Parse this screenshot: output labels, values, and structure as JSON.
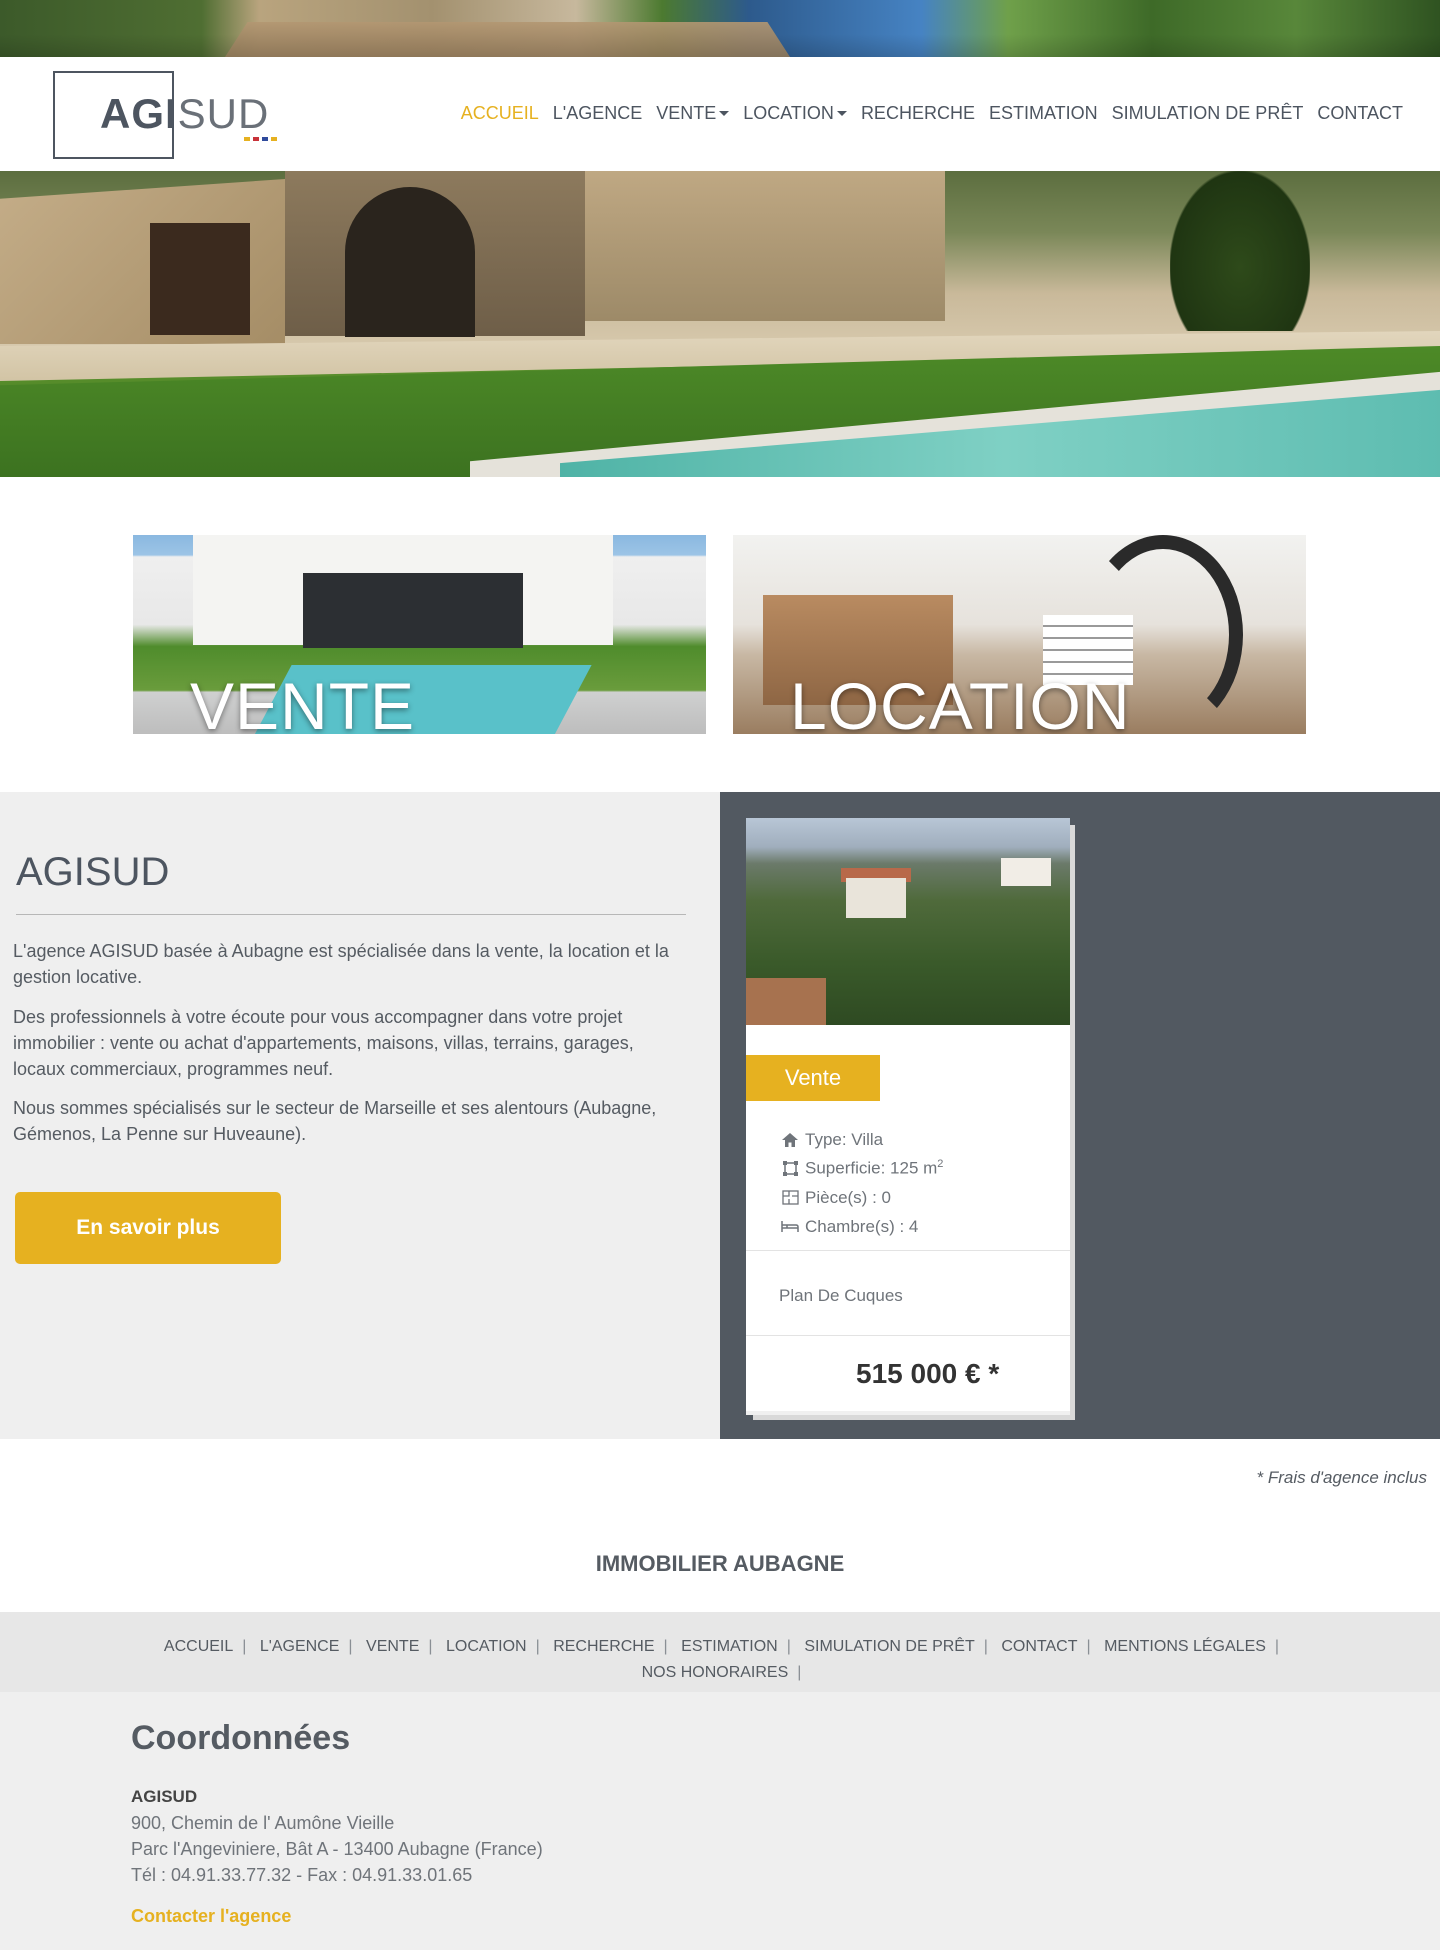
{
  "header": {
    "logo": {
      "part1": "AGI",
      "part2": "SUD",
      "colors": [
        "#e6b120",
        "#c8323a",
        "#2f4a9c",
        "#e6b120"
      ]
    },
    "nav": [
      {
        "label": "ACCUEIL",
        "active": true
      },
      {
        "label": "L'AGENCE"
      },
      {
        "label": "VENTE",
        "dropdown": true
      },
      {
        "label": "LOCATION",
        "dropdown": true
      },
      {
        "label": "RECHERCHE"
      },
      {
        "label": "ESTIMATION"
      },
      {
        "label": "SIMULATION DE PRÊT"
      },
      {
        "label": "CONTACT"
      }
    ]
  },
  "tiles": [
    {
      "label": "VENTE"
    },
    {
      "label": "LOCATION"
    }
  ],
  "about": {
    "title": "AGISUD",
    "paragraphs": [
      "L'agence AGISUD basée à Aubagne est spécialisée dans la vente, la location et la gestion locative.",
      "Des professionnels à votre écoute pour vous accompagner dans votre projet immobilier : vente ou achat d'appartements, maisons, villas, terrains, garages, locaux commerciaux, programmes neuf.",
      "Nous sommes spécialisés sur le secteur de Marseille et ses alentours (Aubagne, Gémenos, La Penne sur Huveaune)."
    ],
    "button": "En savoir plus"
  },
  "listing": {
    "badge": "Vente",
    "type": "Type: Villa",
    "surface": "Superficie: 125 m",
    "surface_sup": "2",
    "rooms": "Pièce(s) : 0",
    "bedrooms": "Chambre(s) : 4",
    "city": "Plan De Cuques",
    "price": "515 000 € *"
  },
  "footnote": "* Frais d'agence inclus",
  "footer": {
    "title": "IMMOBILIER AUBAGNE",
    "links": [
      "ACCUEIL",
      "L'AGENCE",
      "VENTE",
      "LOCATION",
      "RECHERCHE",
      "ESTIMATION",
      "SIMULATION DE PRÊT",
      "CONTACT",
      "MENTIONS LÉGALES",
      "NOS HONORAIRES"
    ],
    "separator": "|"
  },
  "coords": {
    "title": "Coordonnées",
    "name": "AGISUD",
    "address1": "900, Chemin de l' Aumône Vieille",
    "address2": "Parc l'Angeviniere, Bât A - 13400 Aubagne (France)",
    "phone": "Tél : 04.91.33.77.32 - Fax : 04.91.33.01.65",
    "contact_link": "Contacter l'agence"
  }
}
